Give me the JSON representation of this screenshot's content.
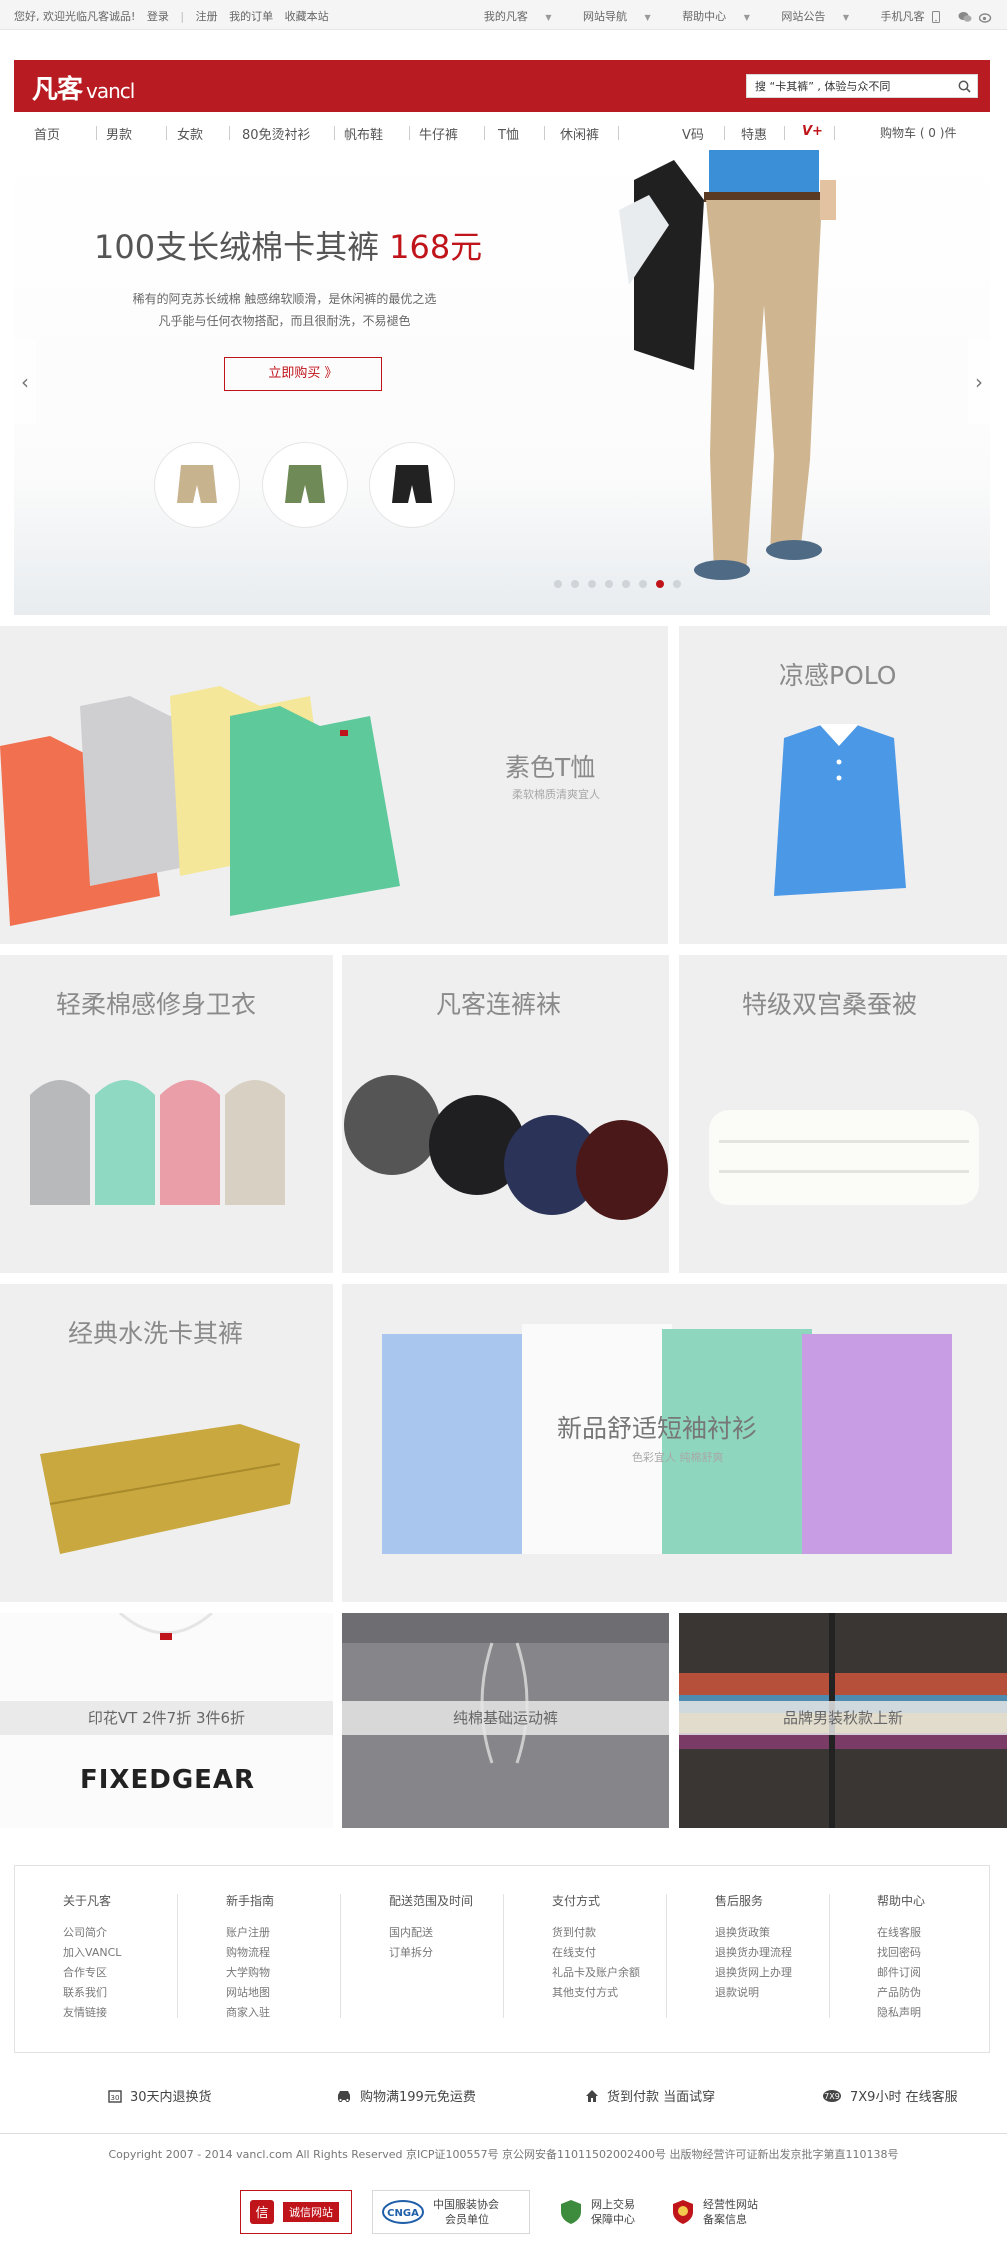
{
  "topbar": {
    "welcome": "您好, 欢迎光临凡客诚品!",
    "login": "登录",
    "register": "注册",
    "my_orders": "我的订单",
    "bookmark": "收藏本站",
    "my_vancl": "我的凡客",
    "site_nav": "网站导航",
    "help_center": "帮助中心",
    "announcements": "网站公告",
    "mobile": "手机凡客"
  },
  "brand": {
    "logo_cn": "凡客",
    "logo_en": "vancl",
    "search_value": "搜 “卡其裤” , 体验与众不同"
  },
  "nav": {
    "items": [
      "首页",
      "男款",
      "女款",
      "80免烫衬衫",
      "帆布鞋",
      "牛仔裤",
      "T恤",
      "休闲裤"
    ],
    "v_code": "V码",
    "special": "特惠",
    "vplus": "V+",
    "cart": "购物车 ( 0 )件"
  },
  "hero": {
    "title": "100支长绒棉卡其裤",
    "price": "168元",
    "desc_line1": "稀有的阿克苏长绒棉   触感绵软顺滑，是休闲裤的最优之选",
    "desc_line2": "凡乎能与任何衣物搭配，而且很耐洗，不易褪色",
    "buy_button": "立即购买 》",
    "slide_count": 8,
    "active_slide": 6
  },
  "tiles": {
    "tshirt_title": "素色T恤",
    "tshirt_sub": "柔软棉质清爽宜人",
    "polo_title": "凉感POLO",
    "hoodie_title": "轻柔棉感修身卫衣",
    "tights_title": "凡客连裤袜",
    "quilt_title": "特级双宫桑蚕被",
    "khaki_title": "经典水洗卡其裤",
    "shirt_title": "新品舒适短袖衬衫",
    "shirt_sub": "色彩宜人 纯棉舒爽",
    "vt_label": "印花VT 2件7折 3件6折",
    "vt_tee_text": "FIXEDGEAR",
    "sweatpants_label": "纯棉基础运动裤",
    "sweater_label": "品牌男装秋款上新"
  },
  "footer": {
    "cols": [
      {
        "title": "关于凡客",
        "links": [
          "公司简介",
          "加入VANCL",
          "合作专区",
          "联系我们",
          "友情链接"
        ]
      },
      {
        "title": "新手指南",
        "links": [
          "账户注册",
          "购物流程",
          "大学购物",
          "网站地图",
          "商家入驻"
        ]
      },
      {
        "title": "配送范围及时间",
        "links": [
          "国内配送",
          "订单拆分"
        ]
      },
      {
        "title": "支付方式",
        "links": [
          "货到付款",
          "在线支付",
          "礼品卡及账户余额",
          "其他支付方式"
        ]
      },
      {
        "title": "售后服务",
        "links": [
          "退换货政策",
          "退换货办理流程",
          "退换货网上办理",
          "退款说明"
        ]
      },
      {
        "title": "帮助中心",
        "links": [
          "在线客服",
          "找回密码",
          "邮件订阅",
          "产品防伪",
          "隐私声明"
        ]
      }
    ],
    "services": [
      "30天内退换货",
      "购物满199元免运费",
      "货到付款 当面试穿",
      "7X9小时 在线客服"
    ],
    "copyright": "Copyright 2007 - 2014 vancl.com All Rights Reserved 京ICP证100557号 京公网安备11011502002400号 出版物经营许可证新出发京批字第直110138号",
    "badges": {
      "credit": "诚信网站",
      "cnga_1": "中国服装协会",
      "cnga_2": "会员单位",
      "trade_1": "网上交易",
      "trade_2": "保障中心",
      "biz_1": "经营性网站",
      "biz_2": "备案信息"
    }
  },
  "colors": {
    "brand_red": "#b81c22",
    "accent_red": "#c0141b",
    "tile_bg": "#efeff0"
  }
}
